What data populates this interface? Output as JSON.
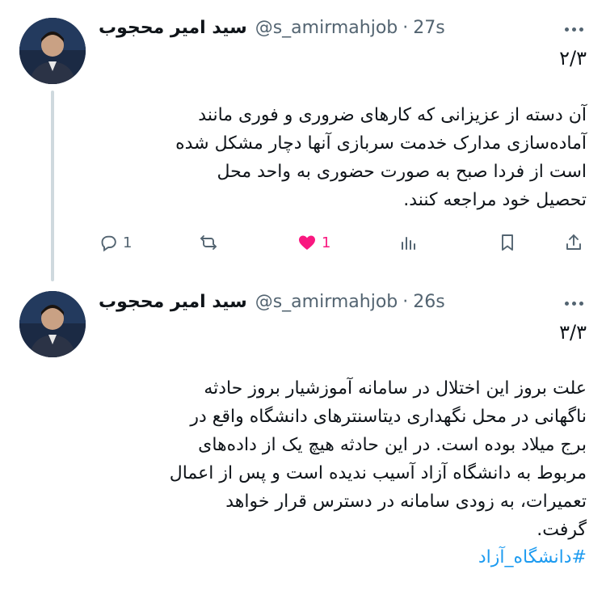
{
  "tweets": [
    {
      "author_name": "سید امیر محجوب",
      "handle": "@s_amirmahjob",
      "time": "27s",
      "separator": "·",
      "counter": "۲/۳",
      "text": "آن دسته از عزیزانی که کارهای ضروری و فوری مانند\nآماده‌سازی مدارک خدمت سربازی آنها دچار مشکل شده\nاست از فردا صبح به صورت حضوری به واحد محل\nتحصیل خود مراجعه کنند.",
      "actions": {
        "reply_count": "1",
        "retweet_count": "",
        "like_count": "1",
        "liked": true
      }
    },
    {
      "author_name": "سید امیر محجوب",
      "handle": "@s_amirmahjob",
      "time": "26s",
      "separator": "·",
      "counter": "۳/۳",
      "text": "علت بروز این اختلال در سامانه آموزشیار بروز حادثه\nناگهانی در محل نگهداری دیتاسنترهای دانشگاه واقع در\nبرج میلاد بوده است. در این حادثه هیچ یک از داده‌های\nمربوط به دانشگاه آزاد آسیب ندیده است و پس از اعمال\nتعمیرات، به زودی سامانه در دسترس قرار خواهد\nگرفت.",
      "hashtag": "#دانشگاه_آزاد"
    }
  ],
  "colors": {
    "accent": "#1d9bf0",
    "like": "#f91880",
    "muted": "#536471",
    "thread_line": "#cfd9de"
  },
  "icons": [
    "reply-icon",
    "retweet-icon",
    "like-icon",
    "views-icon",
    "bookmark-icon",
    "share-icon",
    "more-icon"
  ]
}
